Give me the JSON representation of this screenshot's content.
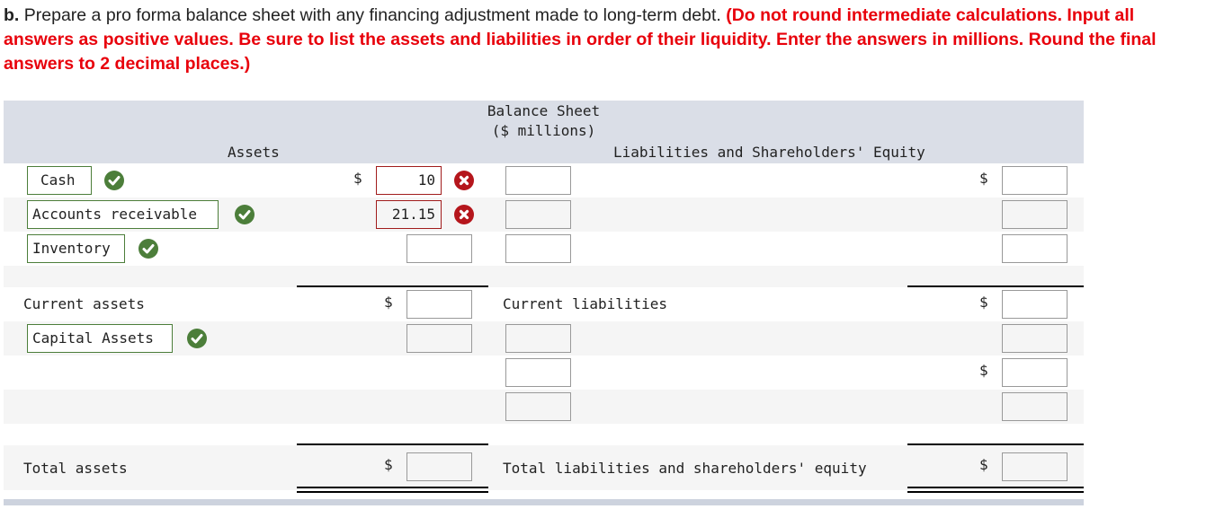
{
  "instructions": {
    "lead": "b.",
    "text": " Prepare a pro forma balance sheet with any financing adjustment made to long-term debt. ",
    "emphasis": "(Do not round intermediate calculations. Input all answers as positive values. Be sure to list the assets and liabilities in order of their liquidity. Enter the answers in millions. Round the final answers to 2 decimal places.)"
  },
  "sheet": {
    "title": "Balance Sheet",
    "subtitle": "($ millions)",
    "assets_header": "Assets",
    "liabilities_header": "Liabilities and Shareholders' Equity",
    "currency": "$",
    "assets": [
      {
        "label": "Cash",
        "label_status": "correct",
        "value": "10",
        "value_status": "incorrect"
      },
      {
        "label": "Accounts receivable",
        "label_status": "correct",
        "value": "21.15",
        "value_status": "incorrect"
      },
      {
        "label": "Inventory",
        "label_status": "correct",
        "value": "",
        "value_status": ""
      }
    ],
    "current_assets": {
      "label": "Current assets",
      "value": ""
    },
    "capital_assets": {
      "label": "Capital Assets",
      "label_status": "correct",
      "value": ""
    },
    "total_assets": {
      "label": "Total assets",
      "value": ""
    },
    "liabilities_top": [
      {
        "label": "",
        "value": ""
      },
      {
        "label": "",
        "value": ""
      },
      {
        "label": "",
        "value": ""
      }
    ],
    "current_liabilities": {
      "label": "Current liabilities",
      "value": ""
    },
    "liabilities_bottom": [
      {
        "label": "",
        "value": ""
      },
      {
        "label": "",
        "value": ""
      },
      {
        "label": "",
        "value": ""
      }
    ],
    "total_liabilities_equity": {
      "label": "Total liabilities and shareholders' equity",
      "value": ""
    }
  },
  "colors": {
    "correct": "#4c7e3a",
    "incorrect": "#b5161c",
    "emphasis": "#e8000b",
    "header_bg": "#dadee7"
  }
}
